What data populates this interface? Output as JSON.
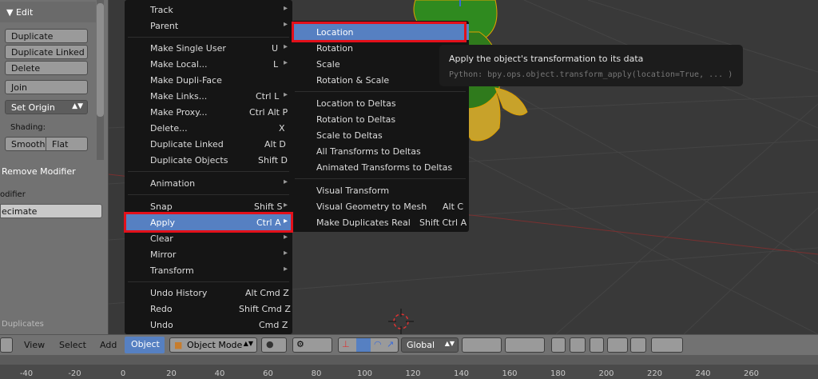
{
  "left_panel": {
    "edit_header": "▼ Edit",
    "buttons": {
      "duplicate": "Duplicate",
      "duplicate_linked": "Duplicate Linked",
      "delete": "Delete",
      "join": "Join",
      "set_origin": "Set Origin"
    },
    "shading_label": "Shading:",
    "smooth": "Smooth",
    "flat": "Flat",
    "remove_modifier": "Remove Modifier",
    "modifier_label": "odifier",
    "modifier_value": "ecimate",
    "bottom_text": "Duplicates"
  },
  "object_menu": {
    "items": [
      {
        "label": "Track",
        "shortcut": "",
        "submenu": true
      },
      {
        "label": "Parent",
        "shortcut": "",
        "submenu": true
      },
      {
        "label": "Make Single User",
        "shortcut": "U",
        "submenu": true
      },
      {
        "label": "Make Local...",
        "shortcut": "L",
        "submenu": true
      },
      {
        "label": "Make Dupli-Face",
        "shortcut": "",
        "submenu": false
      },
      {
        "label": "Make Links...",
        "shortcut": "Ctrl L",
        "submenu": true
      },
      {
        "label": "Make Proxy...",
        "shortcut": "Ctrl Alt P",
        "submenu": false
      },
      {
        "label": "Delete...",
        "shortcut": "X",
        "submenu": false
      },
      {
        "label": "Duplicate Linked",
        "shortcut": "Alt D",
        "submenu": false
      },
      {
        "label": "Duplicate Objects",
        "shortcut": "Shift D",
        "submenu": false
      },
      {
        "label": "Animation",
        "shortcut": "",
        "submenu": true
      },
      {
        "label": "Snap",
        "shortcut": "Shift S",
        "submenu": true
      },
      {
        "label": "Apply",
        "shortcut": "Ctrl A",
        "submenu": true
      },
      {
        "label": "Clear",
        "shortcut": "",
        "submenu": true
      },
      {
        "label": "Mirror",
        "shortcut": "",
        "submenu": true
      },
      {
        "label": "Transform",
        "shortcut": "",
        "submenu": true
      },
      {
        "label": "Undo History",
        "shortcut": "Alt Cmd Z",
        "submenu": false
      },
      {
        "label": "Redo",
        "shortcut": "Shift Cmd Z",
        "submenu": false
      },
      {
        "label": "Undo",
        "shortcut": "Cmd Z",
        "submenu": false
      }
    ]
  },
  "apply_menu": {
    "items": [
      {
        "label": "Location",
        "shortcut": ""
      },
      {
        "label": "Rotation",
        "shortcut": ""
      },
      {
        "label": "Scale",
        "shortcut": ""
      },
      {
        "label": "Rotation & Scale",
        "shortcut": ""
      },
      {
        "label": "Location to Deltas",
        "shortcut": ""
      },
      {
        "label": "Rotation to Deltas",
        "shortcut": ""
      },
      {
        "label": "Scale to Deltas",
        "shortcut": ""
      },
      {
        "label": "All Transforms to Deltas",
        "shortcut": ""
      },
      {
        "label": "Animated Transforms to Deltas",
        "shortcut": ""
      },
      {
        "label": "Visual Transform",
        "shortcut": ""
      },
      {
        "label": "Visual Geometry to Mesh",
        "shortcut": "Alt C"
      },
      {
        "label": "Make Duplicates Real",
        "shortcut": "Shift Ctrl A"
      }
    ]
  },
  "tooltip": {
    "title": "Apply the object's transformation to its data",
    "python": "Python: bpy.ops.object.transform_apply(location=True, ... )"
  },
  "header_bar": {
    "view": "View",
    "select": "Select",
    "add": "Add",
    "object": "Object",
    "mode": "Object Mode",
    "orientation": "Global"
  },
  "timeline": {
    "ticks": [
      "-40",
      "-20",
      "0",
      "20",
      "40",
      "60",
      "80",
      "100",
      "120",
      "140",
      "160",
      "180",
      "200",
      "220",
      "240",
      "260"
    ]
  },
  "colors": {
    "selection": "#5680c2",
    "highlight_box": "#e3101a",
    "model_green": "#2f8a1f",
    "model_outline": "#e0a000"
  }
}
